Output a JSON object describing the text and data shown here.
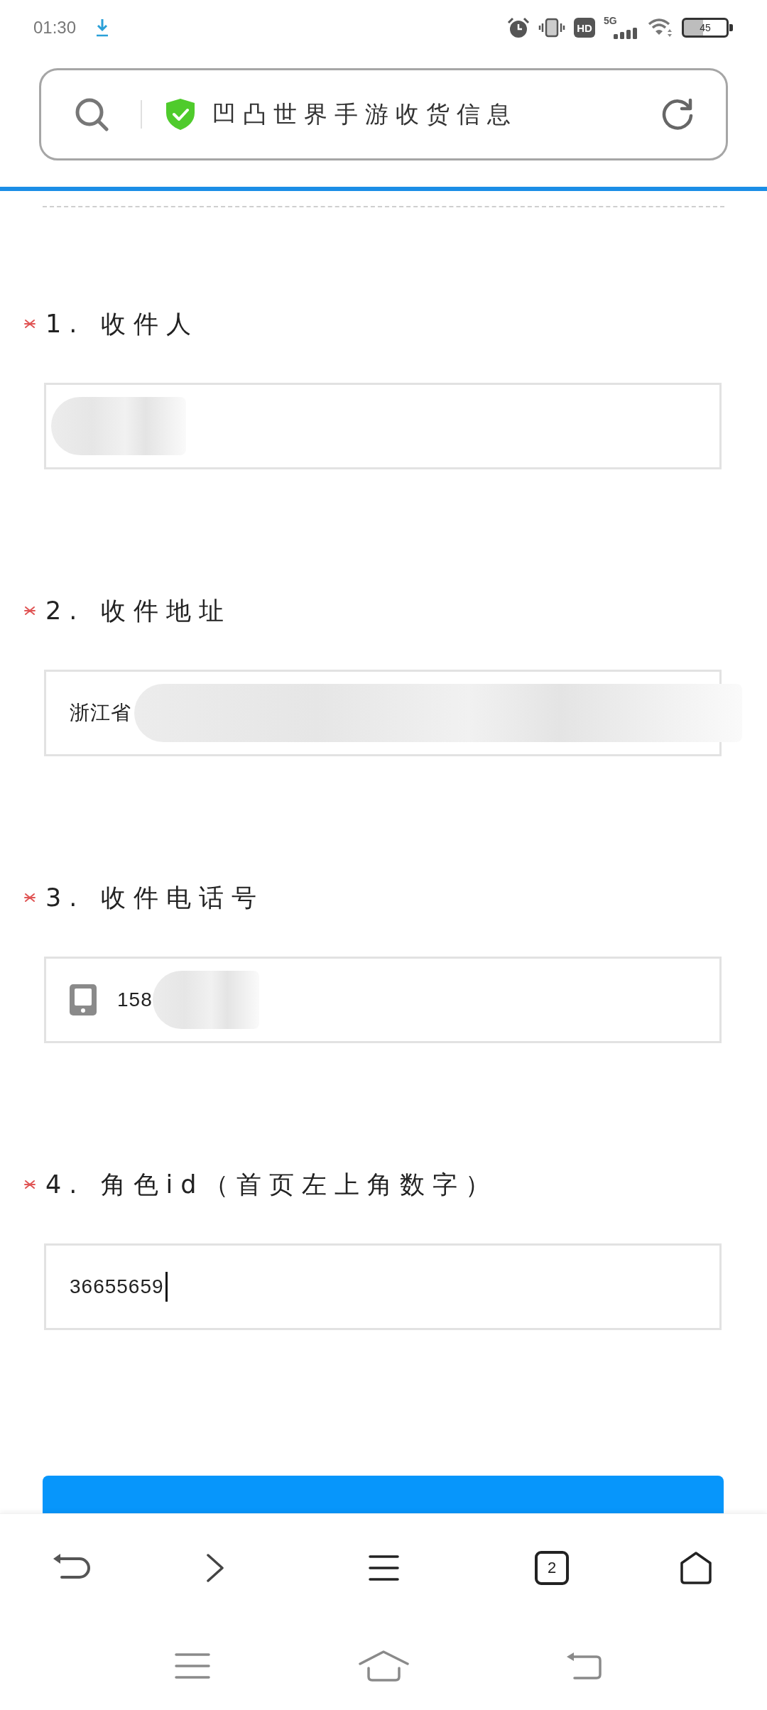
{
  "status_bar": {
    "time": "01:30",
    "hd": "HD",
    "network": "5G",
    "battery": "45"
  },
  "address_bar": {
    "title": "凹凸世界手游收货信息",
    "secure": true
  },
  "form": {
    "questions": [
      {
        "label": "1. 收件人",
        "required": true,
        "field": {
          "kind": "text",
          "redacted": true,
          "focused": false
        }
      },
      {
        "label": "2. 收件地址",
        "required": true,
        "field": {
          "kind": "text",
          "value": "浙江省",
          "redacted": true,
          "focused": false
        }
      },
      {
        "label": "3. 收件电话号",
        "required": true,
        "field": {
          "kind": "phone",
          "value": "158",
          "redacted": true,
          "focused": false
        }
      },
      {
        "label": "4. 角色id（首页左上角数字）",
        "required": true,
        "field": {
          "kind": "text",
          "value": "36655659",
          "redacted": false,
          "focused": true
        }
      }
    ]
  },
  "browser_toolbar": {
    "tab_count": "2"
  }
}
